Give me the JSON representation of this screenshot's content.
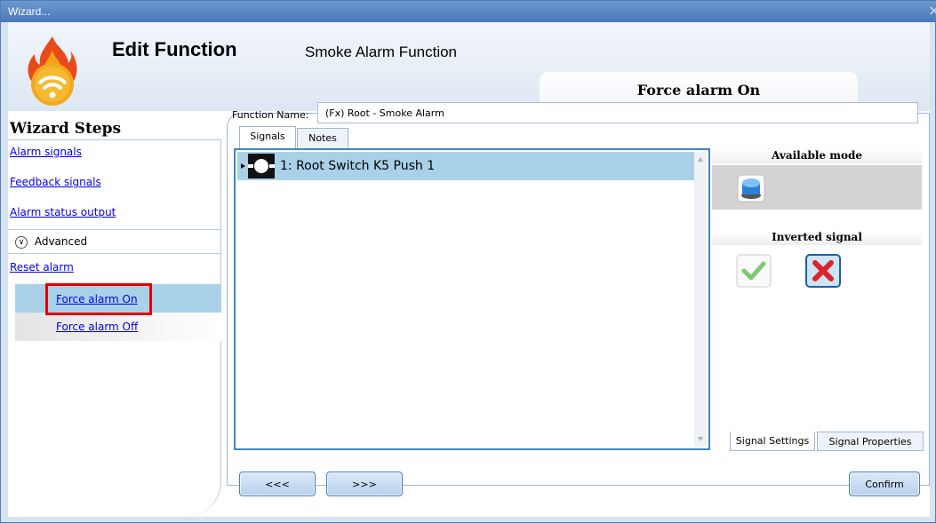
{
  "window": {
    "title": "Wizard...",
    "close_glyph": "×"
  },
  "header": {
    "title": "Edit Function",
    "function_type": "Smoke Alarm Function",
    "current_step": "Force alarm On",
    "logo_icon": "fire-wifi-icon"
  },
  "sidebar": {
    "title": "Wizard Steps",
    "items": [
      {
        "label": "Alarm signals"
      },
      {
        "label": "Feedback signals"
      },
      {
        "label": "Alarm status output"
      },
      {
        "label": "Advanced"
      },
      {
        "label": "Reset alarm"
      },
      {
        "label": "Force alarm On"
      },
      {
        "label": "Force alarm Off"
      }
    ]
  },
  "main": {
    "function_name_label": "Function Name:",
    "function_name_value": "(Fx) Root - Smoke Alarm",
    "tabs": [
      {
        "label": "Signals"
      },
      {
        "label": "Notes"
      }
    ],
    "signals": [
      {
        "label": "1: Root Switch K5 Push 1",
        "icon": "push-switch-icon"
      }
    ]
  },
  "right_panel": {
    "available_mode_title": "Available mode",
    "inverted_signal_title": "Inverted signal",
    "bottom_tabs": [
      {
        "label": "Signal Settings"
      },
      {
        "label": "Signal Properties"
      }
    ]
  },
  "footer": {
    "back_label": "<<<",
    "next_label": ">>>",
    "confirm_label": "Confirm"
  },
  "colors": {
    "highlight_border": "#e30000",
    "selection": "#a9d1e8",
    "link": "#0000ee"
  }
}
